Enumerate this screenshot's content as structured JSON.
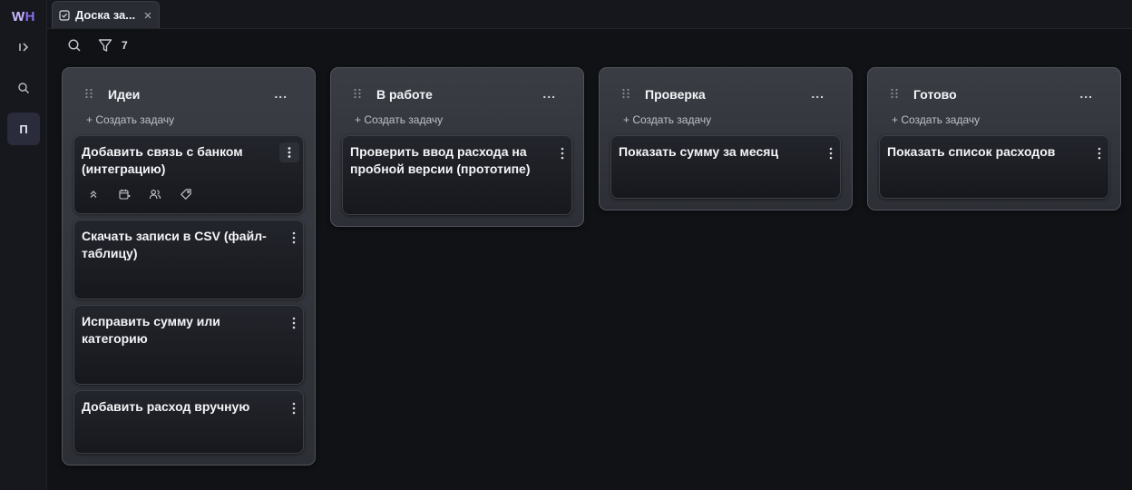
{
  "app": {
    "logo_w": "W",
    "logo_h": "H",
    "project_initial": "П"
  },
  "tab": {
    "label": "Доска за..."
  },
  "toolbar": {
    "filter_count": "7"
  },
  "board": {
    "add_task_label": "+ Создать задачу",
    "more_label": "...",
    "columns": [
      {
        "title": "Идеи",
        "cards": [
          {
            "title": "Добавить связь с банком (интеграцию)"
          },
          {
            "title": "Скачать записи в CSV (файл-таблицу)"
          },
          {
            "title": "Исправить сумму или категорию"
          },
          {
            "title": "Добавить расход вручную"
          }
        ]
      },
      {
        "title": "В работе",
        "cards": [
          {
            "title": "Проверить ввод расхода на пробной версии (прототипе)"
          }
        ]
      },
      {
        "title": "Проверка",
        "cards": [
          {
            "title": "Показать сумму за месяц"
          }
        ]
      },
      {
        "title": "Готово",
        "cards": [
          {
            "title": "Показать список расходов"
          }
        ]
      }
    ]
  },
  "card_quick_actions": [
    "priority-icon",
    "due-date-icon",
    "assignees-icon",
    "tag-icon"
  ],
  "colors": {
    "background": "#111216",
    "rail": "#17181d",
    "column": "#35373e",
    "card": "#1d1f25",
    "accent": "#8a6cf0"
  }
}
